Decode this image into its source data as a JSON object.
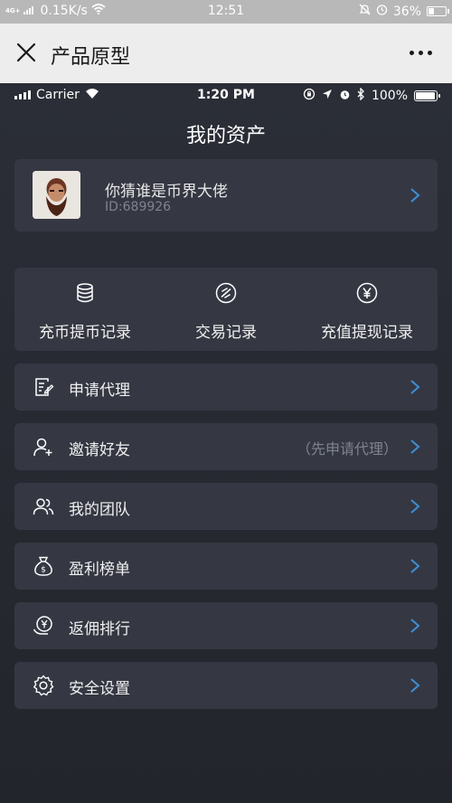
{
  "os_status": {
    "network": "4G+",
    "speed": "0.15K/s",
    "time": "12:51",
    "battery": "36%",
    "battery_level": 0.36
  },
  "wechat": {
    "title": "产品原型"
  },
  "ios_status": {
    "carrier": "Carrier",
    "time": "1:20 PM",
    "battery": "100%",
    "battery_level": 1.0
  },
  "page": {
    "title": "我的资产"
  },
  "profile": {
    "name": "你猜谁是币界大佬",
    "uid": "ID:689926"
  },
  "quick_actions": [
    {
      "label": "充币提币记录",
      "icon": "coins-stack-icon"
    },
    {
      "label": "交易记录",
      "icon": "exchange-icon"
    },
    {
      "label": "充值提现记录",
      "icon": "yuan-icon"
    }
  ],
  "menu": [
    {
      "label": "申请代理",
      "note": "",
      "icon": "document-edit-icon"
    },
    {
      "label": "邀请好友",
      "note": "（先申请代理）",
      "icon": "user-add-icon"
    },
    {
      "label": "我的团队",
      "note": "",
      "icon": "team-icon"
    },
    {
      "label": "盈利榜单",
      "note": "",
      "icon": "money-bag-icon"
    },
    {
      "label": "返佣排行",
      "note": "",
      "icon": "rebate-icon"
    },
    {
      "label": "安全设置",
      "note": "",
      "icon": "gear-icon"
    }
  ],
  "colors": {
    "background": "#2a2d36",
    "card": "#353843",
    "accent_chevron": "#3d8fd6",
    "text_primary": "#f0f0f0",
    "text_secondary": "#7f8390"
  }
}
